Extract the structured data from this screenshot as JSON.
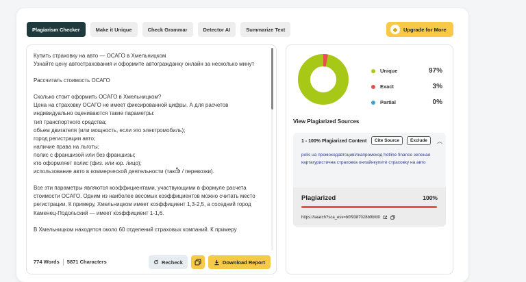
{
  "tabs": [
    {
      "label": "Plagiarism Checker",
      "active": true
    },
    {
      "label": "Make it Unique",
      "active": false
    },
    {
      "label": "Check Grammar",
      "active": false
    },
    {
      "label": "Detector AI",
      "active": false
    },
    {
      "label": "Summarize Text",
      "active": false
    }
  ],
  "upgrade": {
    "label": "Upgrade for More",
    "icon": "diamond-icon"
  },
  "editor": {
    "paragraphs": [
      "Купить страховку на авто — ОСАГО в Хмельницком\nУзнайте цену автострахования и оформите автогражданку онлайн за несколько минут",
      "Рассчитать стоимость ОСАГО",
      "Сколько стоит оформить ОСАГО в Хмельницком?\nЦена на страховку ОСАГО не имеет фиксированной цифры. А для расчетов индивидуально оцениваются такие параметры:\nтип транспортного средства;\nобъем двигателя (или мощность, если это электромобиль);\nгород регистрации авто;\nналичие права на льготы;\nполис с франшизой или без франшизы;\nкто оформляет полис (физ. или юр. лицо);\nиспользование авто в коммерческой деятельности (такси / перевозки).",
      "Все эти параметры являются коэффициентами, участвующими в формуле расчета стоимости ОСАГО. Одним из наиболее весомых коэффициентов можно считать место регистрации. К примеру, Хмельницком имеет коэффициент 1,3-2,5, а соседний город Каменец-Подольский — имеет коэффициент 1-1,6.",
      "В Хмельницком находятся около 60 отделений страховых компаний. К примеру"
    ],
    "words": "774 Words",
    "characters": "5871 Characters",
    "recheck_label": "Recheck",
    "download_label": "Download Report"
  },
  "results": {
    "legend": [
      {
        "label": "Unique",
        "value": "97%",
        "color": "#a8c817"
      },
      {
        "label": "Exact",
        "value": "3%",
        "color": "#e8514b"
      },
      {
        "label": "Partial",
        "value": "0%",
        "color": "#3ba6c9"
      }
    ],
    "chart_data": {
      "type": "pie",
      "categories": [
        "Unique",
        "Exact",
        "Partial"
      ],
      "values": [
        97,
        3,
        0
      ]
    },
    "sources_title": "View Plagiarized Sources",
    "source": {
      "heading": "1 - 100% Plagiarized Content",
      "cite_label": "Cite Source",
      "exclude_label": "Exclude",
      "snippet": "polis ua промокодавтоцивілкапромокод hotline finance зеленая картагуристична страховка онлайнкупити страховку на авто",
      "status_label": "Plagiarized",
      "status_pct": "100%",
      "url": "https://search?sca_esv=b0f9387028b0bfd0"
    }
  }
}
